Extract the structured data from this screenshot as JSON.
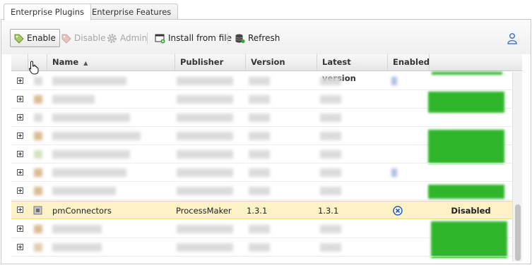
{
  "tabs": [
    {
      "label": "Enterprise Plugins",
      "active": true
    },
    {
      "label": "Enterprise Features",
      "active": false
    }
  ],
  "toolbar": {
    "enable_label": "Enable",
    "disable_label": "Disable",
    "admin_label": "Admin",
    "install_label": "Install from file",
    "refresh_label": "Refresh"
  },
  "columns": {
    "name": "Name",
    "sort_indicator": "▲",
    "publisher": "Publisher",
    "version": "Version",
    "latest_version": "Latest version",
    "enabled": "Enabled"
  },
  "selected_row": {
    "name": "pmConnectors",
    "publisher": "ProcessMaker",
    "version": "1.3.1",
    "latest_version": "1.3.1",
    "enabled_icon": "disabled-x-icon",
    "status": "Disabled"
  },
  "colors": {
    "selected_row_bg": "#fcf2c6",
    "status_green": "#2fb52a",
    "enabled_blue": "#2b5fb8"
  }
}
